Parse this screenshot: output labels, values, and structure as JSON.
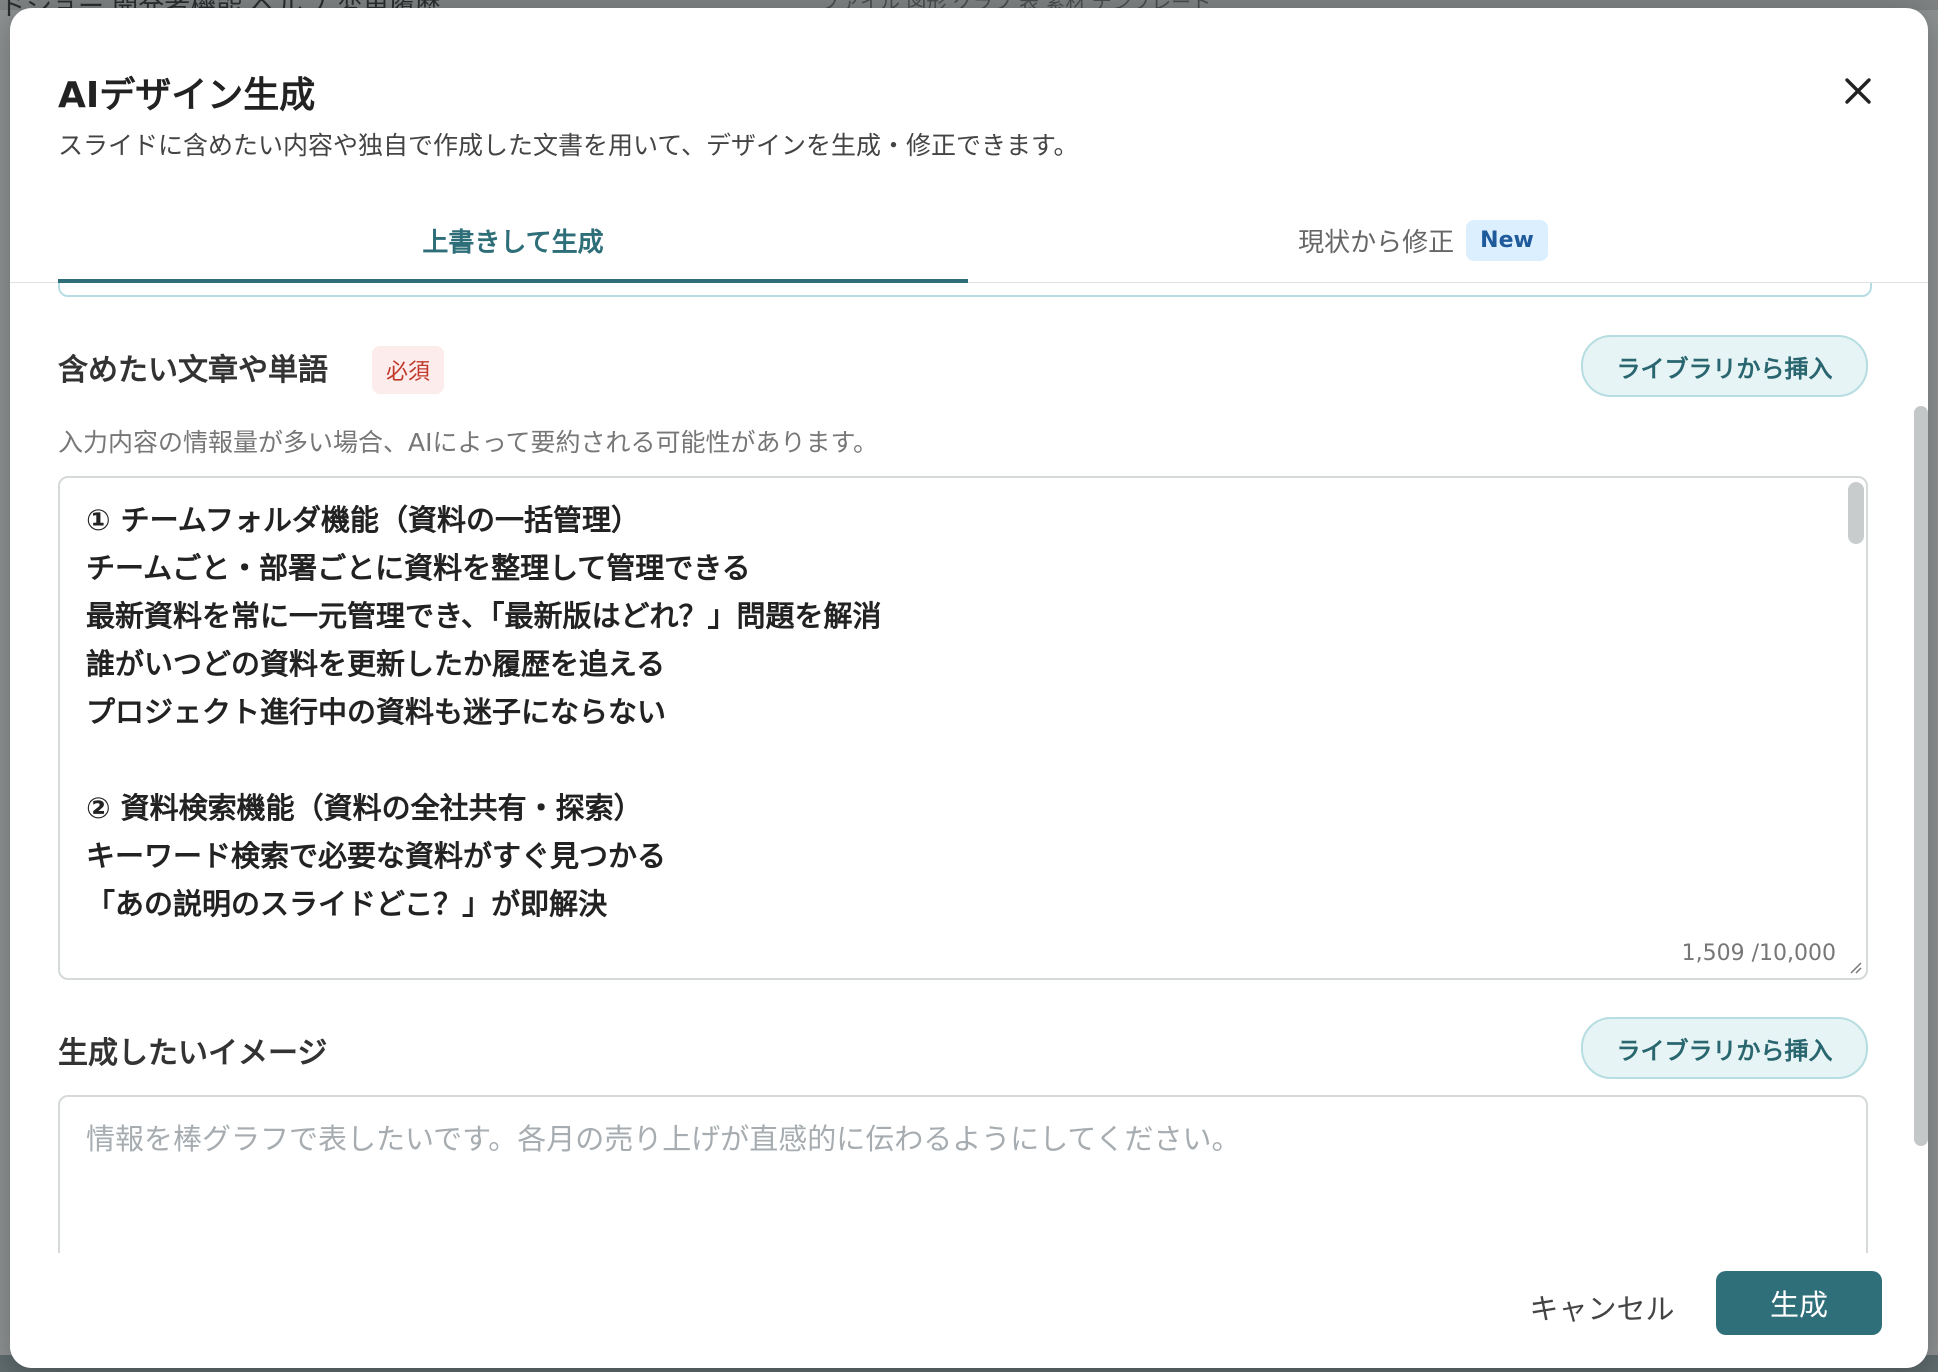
{
  "background": {
    "title": "ドショー 開発者機能 ヘルプ 変更履歴",
    "menu": "ファイル 図形 グラフ 表 素材 テンプレート"
  },
  "modal": {
    "title": "AIデザイン生成",
    "subtitle": "スライドに含めたい内容や独自で作成した文書を用いて、デザインを生成・修正できます。",
    "close_icon": "close-icon"
  },
  "tabs": [
    {
      "label": "上書きして生成",
      "active": true
    },
    {
      "label": "現状から修正",
      "badge": "New",
      "active": false
    }
  ],
  "content_section": {
    "label": "含めたい文章や単語",
    "required_badge": "必須",
    "library_button": "ライブラリから挿入",
    "helper": "入力内容の情報量が多い場合、AIによって要約される可能性があります。",
    "value": "① チームフォルダ機能（資料の一括管理）\nチームごと・部署ごとに資料を整理して管理できる\n最新資料を常に一元管理でき、「最新版はどれ？」問題を解消\n誰がいつどの資料を更新したか履歴を追える\nプロジェクト進行中の資料も迷子にならない\n\n② 資料検索機能（資料の全社共有・探索）\nキーワード検索で必要な資料がすぐ見つかる\n「あの説明のスライドどこ？」が即解決",
    "char_count": "1,509 /10,000"
  },
  "image_section": {
    "label": "生成したいイメージ",
    "library_button": "ライブラリから挿入",
    "placeholder": "情報を棒グラフで表したいです。各月の売り上げが直感的に伝わるようにしてください。"
  },
  "footer": {
    "cancel": "キャンセル",
    "generate": "生成"
  },
  "colors": {
    "accent": "#2f6f7a",
    "required": "#c0392b",
    "new_badge_bg": "#dcefff"
  }
}
